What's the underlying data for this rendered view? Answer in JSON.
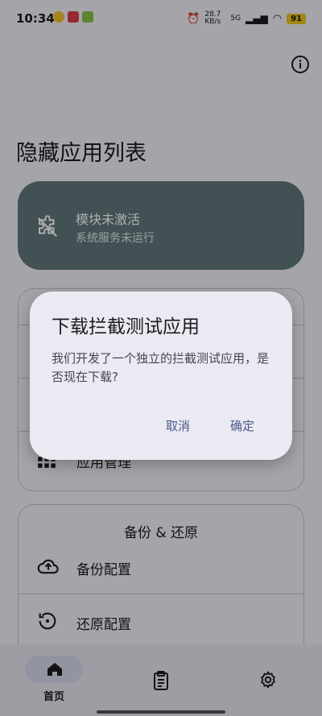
{
  "status_bar": {
    "time": "10:34",
    "network_speed": "28.7 KB/s",
    "network_type": "5G",
    "battery": "91"
  },
  "header": {
    "info_icon": "info-icon",
    "title": "隐藏应用列表"
  },
  "module_status": {
    "icon": "extension-off-icon",
    "title": "模块未激活",
    "subtitle": "系统服务未运行",
    "color": "#60787c"
  },
  "main_card": {
    "partial_item_label": "应用管理",
    "partial_item_icon": "apps-grid-icon"
  },
  "backup_card": {
    "title": "备份 & 还原",
    "items": [
      {
        "label": "备份配置",
        "icon": "cloud-upload-icon"
      },
      {
        "label": "还原配置",
        "icon": "restore-icon"
      }
    ]
  },
  "bottom_nav": {
    "items": [
      {
        "label": "首页",
        "icon": "home-icon",
        "selected": true
      },
      {
        "label": "",
        "icon": "clipboard-icon",
        "selected": false
      },
      {
        "label": "",
        "icon": "gear-icon",
        "selected": false
      }
    ],
    "selected_pill_color": "#d8dbee"
  },
  "dialog": {
    "title": "下载拦截测试应用",
    "message": "我们开发了一个独立的拦截测试应用，是否现在下载?",
    "cancel_label": "取消",
    "confirm_label": "确定",
    "accent": "#4a5a8e"
  }
}
